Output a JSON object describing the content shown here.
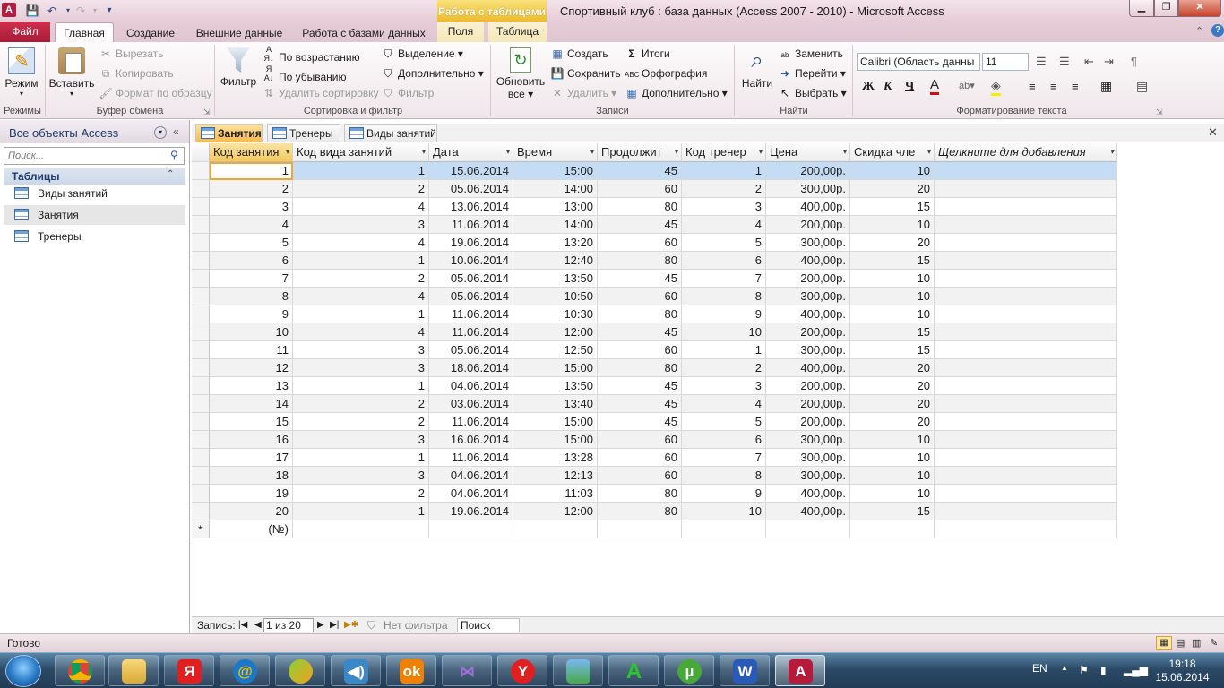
{
  "window": {
    "title": "Спортивный клуб : база данных (Access 2007 - 2010)  -  Microsoft Access",
    "context_tab_group": "Работа с таблицами",
    "app_icon_letter": "A",
    "min": "▁",
    "max": "❐",
    "close": "✕"
  },
  "tabs": {
    "file": "Файл",
    "home": "Главная",
    "create": "Создание",
    "external": "Внешние данные",
    "db_tools": "Работа с базами данных",
    "fields": "Поля",
    "table": "Таблица"
  },
  "ribbon": {
    "views": {
      "mode": "Режим",
      "group": "Режимы"
    },
    "clipboard": {
      "paste": "Вставить",
      "cut": "Вырезать",
      "copy": "Копировать",
      "format_painter": "Формат по образцу",
      "group": "Буфер обмена"
    },
    "sort_filter": {
      "filter": "Фильтр",
      "ascending": "По возрастанию",
      "descending": "По убыванию",
      "remove_sort": "Удалить сортировку",
      "selection": "Выделение ▾",
      "advanced": "Дополнительно ▾",
      "toggle_filter": "Фильтр",
      "group": "Сортировка и фильтр"
    },
    "records": {
      "refresh": "Обновить",
      "refresh2": "все ▾",
      "new": "Создать",
      "save": "Сохранить",
      "delete": "Удалить ▾",
      "totals": "Итоги",
      "spelling": "Орфография",
      "more": "Дополнительно ▾",
      "group": "Записи"
    },
    "find": {
      "find": "Найти",
      "replace": "Заменить",
      "goto": "Перейти ▾",
      "select": "Выбрать ▾",
      "group": "Найти"
    },
    "text_format": {
      "font": "Calibri (Область данны",
      "size": "11",
      "group": "Форматирование текста",
      "bold": "Ж",
      "italic": "К",
      "underline": "Ч"
    }
  },
  "nav": {
    "header": "Все объекты Access",
    "search_placeholder": "Поиск...",
    "section": "Таблицы",
    "items": [
      {
        "label": "Виды занятий"
      },
      {
        "label": "Занятия"
      },
      {
        "label": "Тренеры"
      }
    ]
  },
  "doc_tabs": [
    {
      "label": "Занятия"
    },
    {
      "label": "Тренеры"
    },
    {
      "label": "Виды занятий"
    }
  ],
  "table": {
    "columns": [
      "Код занятия",
      "Код вида занятий",
      "Дата",
      "Время",
      "Продолжит",
      "Код тренер",
      "Цена",
      "Скидка чле",
      "Щелкните для добавления"
    ],
    "rows": [
      [
        "1",
        "1",
        "15.06.2014",
        "15:00",
        "45",
        "1",
        "200,00р.",
        "10"
      ],
      [
        "2",
        "2",
        "05.06.2014",
        "14:00",
        "60",
        "2",
        "300,00р.",
        "20"
      ],
      [
        "3",
        "4",
        "13.06.2014",
        "13:00",
        "80",
        "3",
        "400,00р.",
        "15"
      ],
      [
        "4",
        "3",
        "11.06.2014",
        "14:00",
        "45",
        "4",
        "200,00р.",
        "10"
      ],
      [
        "5",
        "4",
        "19.06.2014",
        "13:20",
        "60",
        "5",
        "300,00р.",
        "20"
      ],
      [
        "6",
        "1",
        "10.06.2014",
        "12:40",
        "80",
        "6",
        "400,00р.",
        "15"
      ],
      [
        "7",
        "2",
        "05.06.2014",
        "13:50",
        "45",
        "7",
        "200,00р.",
        "10"
      ],
      [
        "8",
        "4",
        "05.06.2014",
        "10:50",
        "60",
        "8",
        "300,00р.",
        "10"
      ],
      [
        "9",
        "1",
        "11.06.2014",
        "10:30",
        "80",
        "9",
        "400,00р.",
        "10"
      ],
      [
        "10",
        "4",
        "11.06.2014",
        "12:00",
        "45",
        "10",
        "200,00р.",
        "15"
      ],
      [
        "11",
        "3",
        "05.06.2014",
        "12:50",
        "60",
        "1",
        "300,00р.",
        "15"
      ],
      [
        "12",
        "3",
        "18.06.2014",
        "15:00",
        "80",
        "2",
        "400,00р.",
        "20"
      ],
      [
        "13",
        "1",
        "04.06.2014",
        "13:50",
        "45",
        "3",
        "200,00р.",
        "20"
      ],
      [
        "14",
        "2",
        "03.06.2014",
        "13:40",
        "45",
        "4",
        "200,00р.",
        "20"
      ],
      [
        "15",
        "2",
        "11.06.2014",
        "15:00",
        "45",
        "5",
        "200,00р.",
        "20"
      ],
      [
        "16",
        "3",
        "16.06.2014",
        "15:00",
        "60",
        "6",
        "300,00р.",
        "10"
      ],
      [
        "17",
        "1",
        "11.06.2014",
        "13:28",
        "60",
        "7",
        "300,00р.",
        "10"
      ],
      [
        "18",
        "3",
        "04.06.2014",
        "12:13",
        "60",
        "8",
        "300,00р.",
        "10"
      ],
      [
        "19",
        "2",
        "04.06.2014",
        "11:03",
        "80",
        "9",
        "400,00р.",
        "10"
      ],
      [
        "20",
        "1",
        "19.06.2014",
        "12:00",
        "80",
        "10",
        "400,00р.",
        "15"
      ]
    ],
    "new_row_marker": "*",
    "new_row_value": "(№)"
  },
  "record_nav": {
    "label": "Запись:",
    "position": "1 из 20",
    "filter": "Нет фильтра",
    "search": "Поиск"
  },
  "status": {
    "text": "Готово"
  },
  "taskbar": {
    "lang": "EN",
    "time": "19:18",
    "date": "15.06.2014"
  },
  "colors": {
    "selected_row": "#c5dcf5",
    "alt_row": "#f2f2f2",
    "current_cell_border": "#f0a830"
  }
}
